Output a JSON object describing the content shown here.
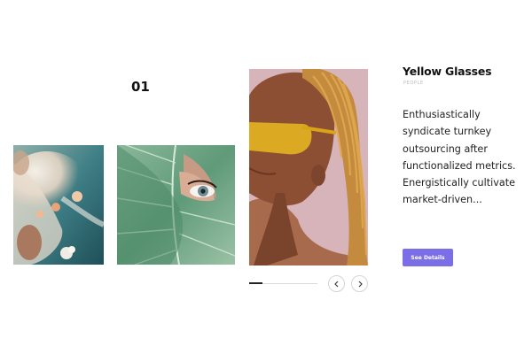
{
  "slider": {
    "number": "01",
    "progress": 0.2
  },
  "item": {
    "title": "Yellow Glasses",
    "category": "PEOPLE",
    "description": "Enthusiastically syndicate turnkey outsourcing after functionalized metrics. Energistically cultivate market-driven...",
    "button_label": "See Details"
  },
  "thumbnails": [
    {
      "subject": "woman-in-water-with-flowers-photo"
    },
    {
      "subject": "eye-behind-leaf-photo"
    },
    {
      "subject": "woman-with-yellow-glasses-photo"
    }
  ],
  "icons": {
    "prev": "chevron-left-icon",
    "next": "chevron-right-icon"
  },
  "colors": {
    "accent": "#7b6ee6",
    "text": "#111111",
    "muted": "#b8b8b8"
  }
}
